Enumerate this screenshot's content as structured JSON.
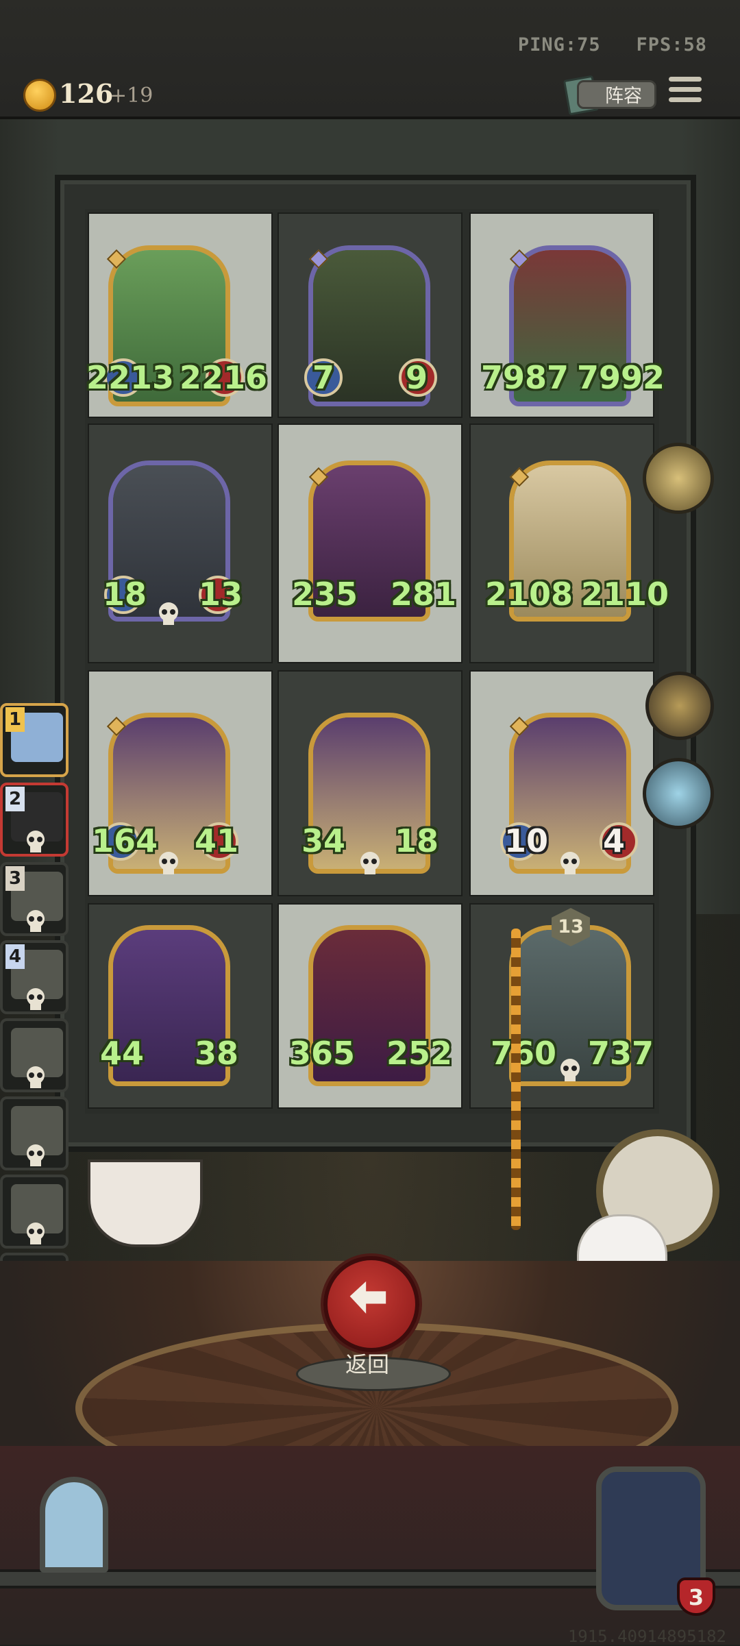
{
  "status": {
    "ping": "PING:75",
    "fps": "FPS:58"
  },
  "currency": {
    "gold": "126",
    "increment": "+19"
  },
  "header": {
    "lineup_label": "阵容"
  },
  "board": {
    "units": [
      {
        "attack": "2213",
        "health": "2216",
        "frame": "gold"
      },
      {
        "attack": "7",
        "health": "9",
        "frame": "purple"
      },
      {
        "attack": "7987",
        "health": "7992",
        "frame": "purple"
      },
      {
        "attack": "18",
        "health": "13",
        "frame": "purple"
      },
      {
        "attack": "235",
        "health": "281",
        "frame": "gold"
      },
      {
        "attack": "2108",
        "health": "2110",
        "frame": "gold"
      },
      {
        "attack": "164",
        "health": "41",
        "frame": "gold"
      },
      {
        "attack": "34",
        "health": "18",
        "frame": "gold"
      },
      {
        "attack": "10",
        "health": "4",
        "frame": "gold"
      },
      {
        "attack": "44",
        "health": "38",
        "frame": "gold"
      },
      {
        "attack": "365",
        "health": "252",
        "frame": "gold"
      },
      {
        "attack": "760",
        "health": "737",
        "frame": "gold"
      }
    ],
    "unit_level_badge": "13"
  },
  "roster": {
    "slots": [
      {
        "number": "1"
      },
      {
        "number": "2"
      },
      {
        "number": "3"
      },
      {
        "number": "4"
      },
      {
        "number": ""
      },
      {
        "number": ""
      },
      {
        "number": ""
      },
      {
        "number": ""
      }
    ]
  },
  "actions": {
    "return_label": "返回"
  },
  "player": {
    "level": "3"
  },
  "footer": {
    "id_text": "1915.40914895182"
  },
  "colors": {
    "stat_text": "#b9f08c",
    "gold_frame": "#c99a3b",
    "purple_frame": "#6d66a8",
    "return_button": "#c43a33"
  }
}
